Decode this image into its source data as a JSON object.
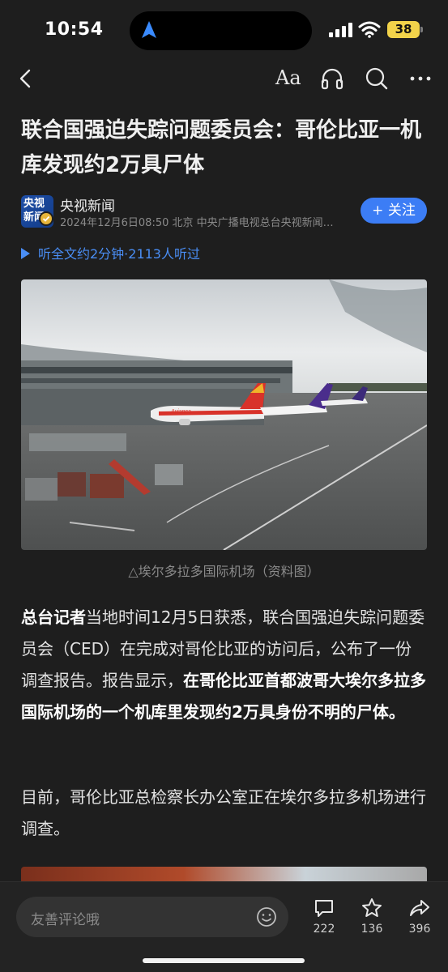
{
  "status": {
    "time": "10:54",
    "battery": "38",
    "icons": [
      "navigation-arrow-icon",
      "signal-icon",
      "wifi-icon",
      "battery-icon"
    ]
  },
  "nav": {
    "font_label": "Aa",
    "icons": [
      "back-icon",
      "font-size-icon",
      "headphone-icon",
      "search-icon",
      "more-icon"
    ]
  },
  "article": {
    "headline": "联合国强迫失踪问题委员会：哥伦比亚一机库发现约2万具尸体",
    "source": {
      "logo_text_1": "央视",
      "logo_text_2": "新闻",
      "name": "央视新闻",
      "meta": "2024年12月6日08:50 北京 中央广播电视总台央视新闻…",
      "follow_label": "+ 关注"
    },
    "listen": "听全文约2分钟·2113人听过",
    "caption": "△埃尔多拉多国际机场（资料图）",
    "para1": {
      "lead_bold": "总台记者",
      "text1": "当地时间12月5日获悉，联合国强迫失踪问题委员会（CED）在完成对哥伦比亚的访问后，公布了一份调查报告。报告显示，",
      "bold2": "在哥伦比亚首都波哥大埃尔多拉多国际机场的一个机库里发现约2万具身份不明的尸体。"
    },
    "para2": "目前，哥伦比亚总检察长办公室正在埃尔多拉多机场进行调查。"
  },
  "photo": {
    "plane_livery_text": "Avianca",
    "colors": {
      "sky": "#dfe3e6",
      "tarmac": "#5b5e5e",
      "red_tail": "#d8322a",
      "purple_tail": "#4a2d8c"
    }
  },
  "bottom": {
    "comment_placeholder": "友善评论哦",
    "comment_count": "222",
    "star_count": "136",
    "share_count": "396"
  },
  "colors": {
    "accent": "#3c7df5",
    "background": "#1e1e1e"
  }
}
